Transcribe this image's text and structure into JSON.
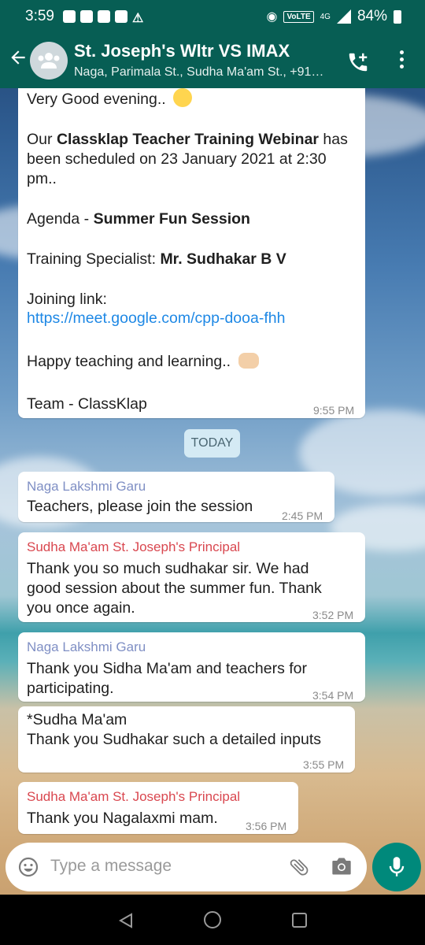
{
  "status_bar": {
    "time": "3:59",
    "volte": "VoLTE",
    "network": "4G",
    "battery": "84%"
  },
  "header": {
    "title": "St. Joseph's Wltr VS IMAX",
    "subtitle": "Naga, Parimala St., Sudha Ma'am St., +91…"
  },
  "messages": {
    "m1": {
      "greeting": "Very Good evening..",
      "para1_l1_a": "Our ",
      "para1_l1_b": "Classklap Teacher Training Webinar",
      "para1_l1_c": " has",
      "para1_l2": "been scheduled on 23 January 2021 at 2:30",
      "para1_l3": "pm..",
      "agenda_label": "Agenda - ",
      "agenda_value": "Summer Fun Session",
      "specialist_label": "Training Specialist: ",
      "specialist_value": "Mr. Sudhakar B V",
      "link_label": "Joining link:",
      "link": "https://meet.google.com/cpp-dooa-fhh",
      "happy": "Happy teaching and learning..",
      "team": "Team - ClassKlap",
      "time": "9:55 PM"
    },
    "today": "TODAY",
    "m2": {
      "sender": "Naga Lakshmi Garu",
      "text": "Teachers, please join the session",
      "time": "2:45 PM"
    },
    "m3": {
      "sender": "Sudha Ma'am St. Joseph's Principal",
      "l1": "Thank you so much sudhakar sir. We had",
      "l2": "good session about the summer fun. Thank",
      "l3": "you once again.",
      "time": "3:52 PM"
    },
    "m4": {
      "sender": "Naga Lakshmi Garu",
      "l1": "Thank you Sidha Ma'am and teachers for",
      "l2": "participating.",
      "time": "3:54 PM"
    },
    "m5": {
      "l1": "*Sudha Ma'am",
      "l2": "Thank you Sudhakar such a  detailed  inputs",
      "time": "3:55 PM"
    },
    "m6": {
      "sender": "Sudha Ma'am St. Joseph's Principal",
      "text": "Thank you Nagalaxmi mam.",
      "time": "3:56 PM"
    }
  },
  "composer": {
    "placeholder": "Type a message"
  },
  "colors": {
    "header": "#075e54",
    "mic_button": "#00897b",
    "sender_blue": "#7f8fc4",
    "sender_red": "#d9474f",
    "link": "#1e88e5"
  }
}
